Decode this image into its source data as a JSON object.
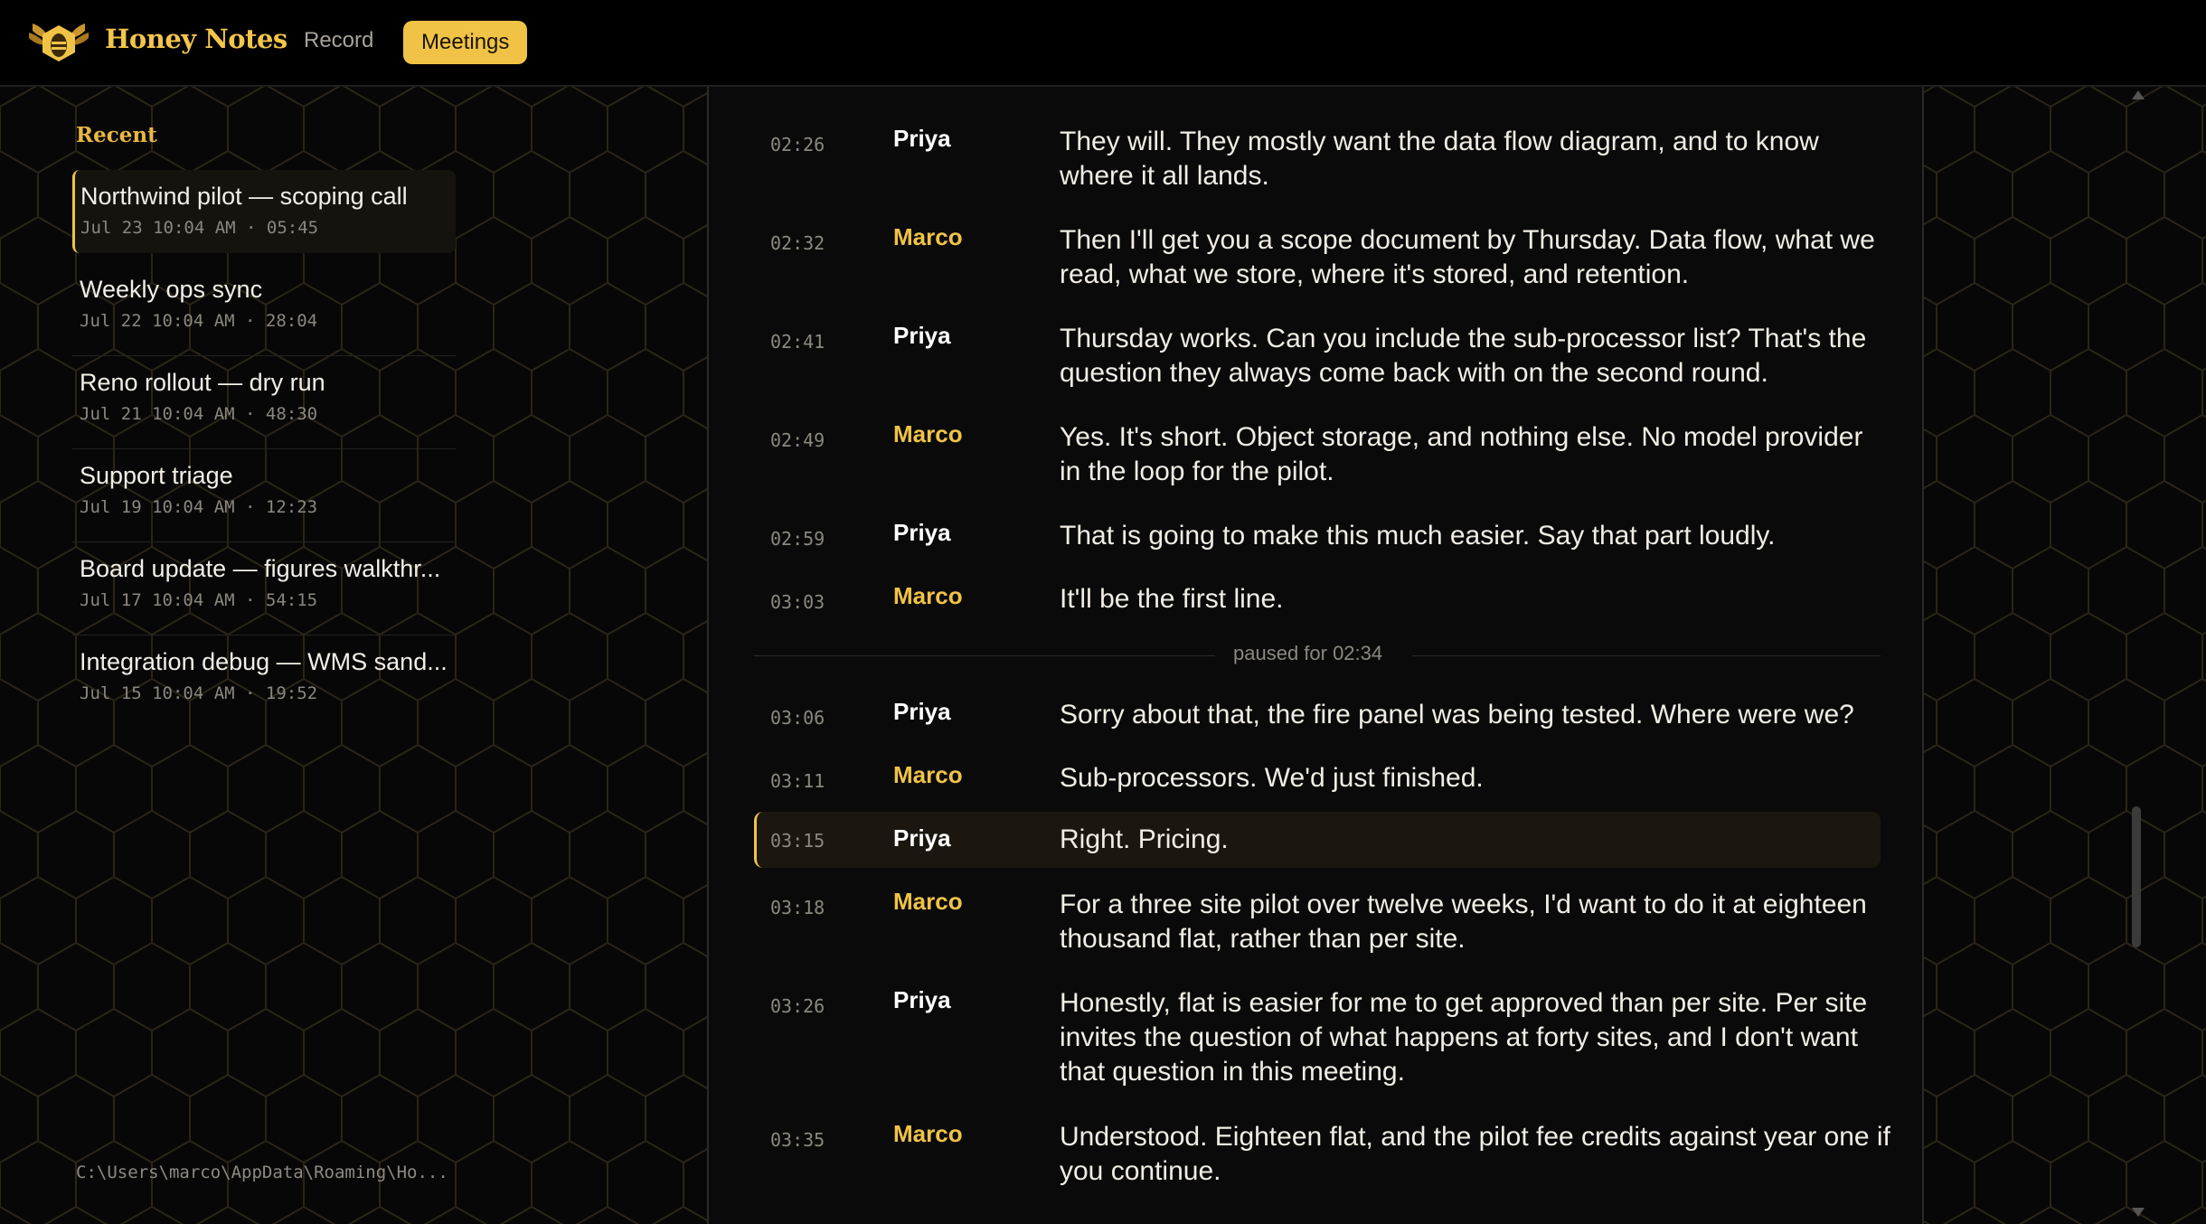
{
  "header": {
    "brand": "Honey Notes",
    "nav": {
      "record": "Record",
      "meetings": "Meetings"
    }
  },
  "sidebar": {
    "recent_title": "Recent",
    "meetings": [
      {
        "title": "Northwind pilot — scoping call",
        "meta": "Jul 23 10:04 AM · 05:45",
        "active": true
      },
      {
        "title": "Weekly ops sync",
        "meta": "Jul 22 10:04 AM · 28:04"
      },
      {
        "title": "Reno rollout — dry run",
        "meta": "Jul 21 10:04 AM · 48:30"
      },
      {
        "title": "Support triage",
        "meta": "Jul 19 10:04 AM · 12:23"
      },
      {
        "title": "Board update — figures walkthr...",
        "meta": "Jul 17 10:04 AM · 54:15"
      },
      {
        "title": "Integration debug — WMS sand...",
        "meta": "Jul 15 10:04 AM · 19:52"
      }
    ],
    "path": "C:\\Users\\marco\\AppData\\Roaming\\Ho..."
  },
  "transcript": {
    "lines": [
      {
        "time": "02:26",
        "speaker": "Priya",
        "text": "They will. They mostly want the data flow diagram, and to know where it all lands."
      },
      {
        "time": "02:32",
        "speaker": "Marco",
        "text": "Then I'll get you a scope document by Thursday. Data flow, what we read, what we store, where it's stored, and retention."
      },
      {
        "time": "02:41",
        "speaker": "Priya",
        "text": "Thursday works. Can you include the sub-processor list? That's the question they always come back with on the second round."
      },
      {
        "time": "02:49",
        "speaker": "Marco",
        "text": "Yes. It's short. Object storage, and nothing else. No model provider in the loop for the pilot."
      },
      {
        "time": "02:59",
        "speaker": "Priya",
        "text": "That is going to make this much easier. Say that part loudly."
      },
      {
        "time": "03:03",
        "speaker": "Marco",
        "text": "It'll be the first line."
      },
      {
        "time": "03:06",
        "speaker": "Priya",
        "text": "Sorry about that, the fire panel was being tested. Where were we?"
      },
      {
        "time": "03:11",
        "speaker": "Marco",
        "text": "Sub-processors. We'd just finished."
      },
      {
        "time": "03:15",
        "speaker": "Priya",
        "text": "Right. Pricing."
      },
      {
        "time": "03:18",
        "speaker": "Marco",
        "text": "For a three site pilot over twelve weeks, I'd want to do it at eighteen thousand flat, rather than per site."
      },
      {
        "time": "03:26",
        "speaker": "Priya",
        "text": "Honestly, flat is easier for me to get approved than per site. Per site invites the question of what happens at forty sites, and I don't want that question in this meeting."
      },
      {
        "time": "03:35",
        "speaker": "Marco",
        "text": "Understood. Eighteen flat, and the pilot fee credits against year one if you continue."
      }
    ],
    "pause_text": "paused for 02:34",
    "highlighted_time": "03:15"
  },
  "colors": {
    "accent": "#f0c347",
    "background": "#070707",
    "panel": "#0a0a0a"
  },
  "icons": {
    "logo": "honey-bee-logo-icon"
  }
}
